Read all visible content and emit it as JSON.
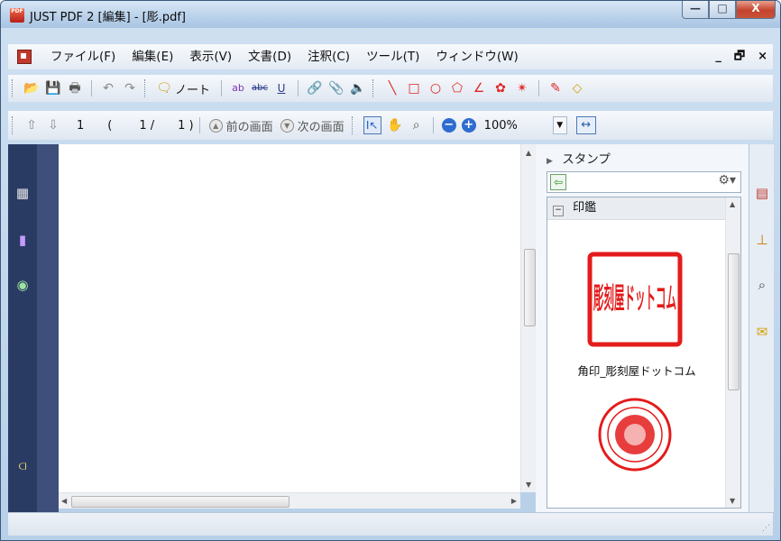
{
  "window": {
    "title": "JUST PDF 2 [編集] - [彫.pdf]",
    "app_icon_text": "PDF"
  },
  "window_controls": {
    "minimize": "—",
    "maximize": "□",
    "close": "X"
  },
  "menubar": {
    "items": [
      "ファイル(F)",
      "編集(E)",
      "表示(V)",
      "文書(D)",
      "注釈(C)",
      "ツール(T)",
      "ウィンドウ(W)"
    ],
    "doc_controls": {
      "minimize": "_",
      "restore": "🗗",
      "close": "×"
    }
  },
  "toolbar1": {
    "note_label": "ノート"
  },
  "toolbar2": {
    "current_page": "1",
    "page_open": "(",
    "page_index": "1 /",
    "page_total": "1 )",
    "prev_view": "前の画面",
    "next_view": "次の画面",
    "zoom": "100%"
  },
  "stamp_panel": {
    "title": "スタンプ",
    "category": "印鑑",
    "stamps": [
      {
        "name": "角印_彫刻屋ドットコム",
        "glyphs": "彫刻屋ドットコム"
      },
      {
        "name": "",
        "glyphs": ""
      }
    ]
  },
  "colors": {
    "stamp_red": "#e41b1b",
    "sidebar_dark": "#2a3b63",
    "accent_blue": "#2f6ccf"
  }
}
